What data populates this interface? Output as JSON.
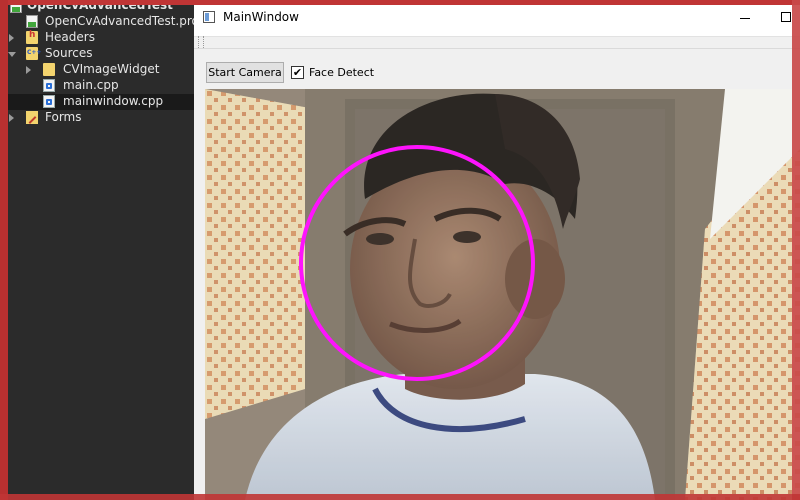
{
  "project_tree": {
    "root": "OpenCvAdvancedTest",
    "items": [
      {
        "label": "OpenCvAdvancedTest.pro"
      },
      {
        "label": "Headers"
      },
      {
        "label": "Sources"
      },
      {
        "label": "CVImageWidget"
      },
      {
        "label": "main.cpp"
      },
      {
        "label": "mainwindow.cpp"
      },
      {
        "label": "Forms"
      }
    ]
  },
  "window": {
    "title": "MainWindow"
  },
  "controls": {
    "start_button": "Start Camera",
    "face_detect_label": "Face Detect",
    "face_detect_checked": true,
    "check_mark": "✔"
  },
  "camera": {
    "face_circle_color": "#ff00ff"
  },
  "colors": {
    "highlight_frame": "#c03535",
    "tree_bg": "#2b2b2b"
  }
}
